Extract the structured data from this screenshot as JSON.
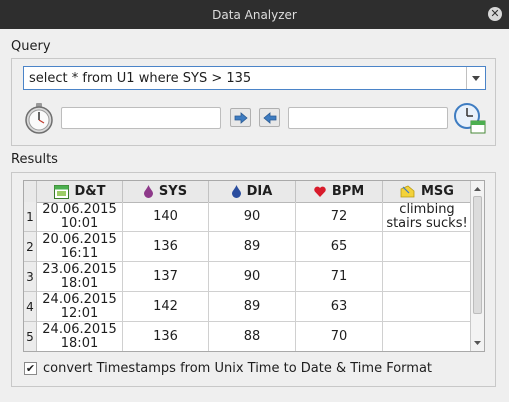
{
  "window": {
    "title": "Data Analyzer",
    "close_symbol": "✕"
  },
  "query": {
    "group_label": "Query",
    "sql": "select * from U1 where SYS > 135",
    "from_field": "",
    "to_field": ""
  },
  "results": {
    "group_label": "Results",
    "columns": [
      {
        "label": "D&T",
        "icon": "calendar-icon"
      },
      {
        "label": "SYS",
        "icon": "blood-drop-purple-icon"
      },
      {
        "label": "DIA",
        "icon": "blood-drop-blue-icon"
      },
      {
        "label": "BPM",
        "icon": "heart-icon"
      },
      {
        "label": "MSG",
        "icon": "sticky-note-icon"
      }
    ],
    "rows": [
      {
        "num": "1",
        "date": "20.06.2015",
        "time": "10:01",
        "sys": "140",
        "dia": "90",
        "bpm": "72",
        "msg": "climbing stairs sucks!"
      },
      {
        "num": "2",
        "date": "20.06.2015",
        "time": "16:11",
        "sys": "136",
        "dia": "89",
        "bpm": "65",
        "msg": ""
      },
      {
        "num": "3",
        "date": "23.06.2015",
        "time": "18:01",
        "sys": "137",
        "dia": "90",
        "bpm": "71",
        "msg": ""
      },
      {
        "num": "4",
        "date": "24.06.2015",
        "time": "12:01",
        "sys": "142",
        "dia": "89",
        "bpm": "63",
        "msg": ""
      },
      {
        "num": "5",
        "date": "24.06.2015",
        "time": "18:01",
        "sys": "136",
        "dia": "88",
        "bpm": "70",
        "msg": ""
      }
    ]
  },
  "options": {
    "convert_timestamps_label": "convert Timestamps from Unix Time to Date & Time Format",
    "convert_timestamps_checked": true,
    "check_mark": "✔"
  },
  "colors": {
    "accent": "#4b84c8",
    "title_bar": "#2e2e2e",
    "arrow_blue": "#3e7cc1"
  }
}
